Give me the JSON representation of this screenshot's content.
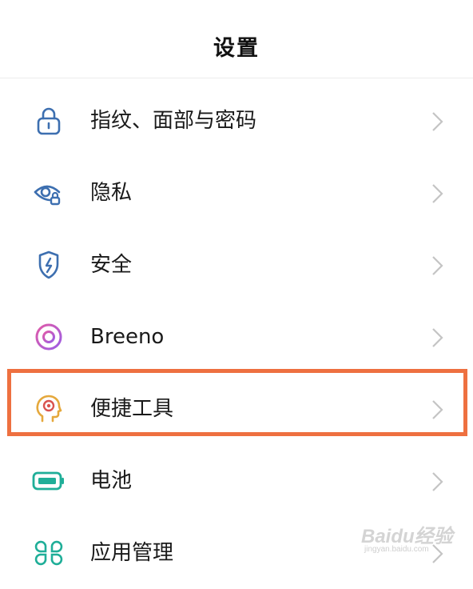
{
  "header": {
    "title": "设置"
  },
  "settings": {
    "items": [
      {
        "label": "指纹、面部与密码",
        "icon": "lock-icon",
        "color": "#3d6fb0"
      },
      {
        "label": "隐私",
        "icon": "privacy-eye-icon",
        "color": "#3d6fb0"
      },
      {
        "label": "安全",
        "icon": "security-shield-icon",
        "color": "#3d6fb0"
      },
      {
        "label": "Breeno",
        "icon": "breeno-icon",
        "color": "#c65ad6"
      },
      {
        "label": "便捷工具",
        "icon": "convenience-tools-icon",
        "color": "#e5a83c",
        "highlighted": true
      },
      {
        "label": "电池",
        "icon": "battery-icon",
        "color": "#1fae98"
      },
      {
        "label": "应用管理",
        "icon": "app-management-icon",
        "color": "#1fae98"
      }
    ]
  },
  "highlight": {
    "color": "#ee7040"
  },
  "watermark": {
    "logo": "Baidu经验",
    "url": "jingyan.baidu.com"
  }
}
